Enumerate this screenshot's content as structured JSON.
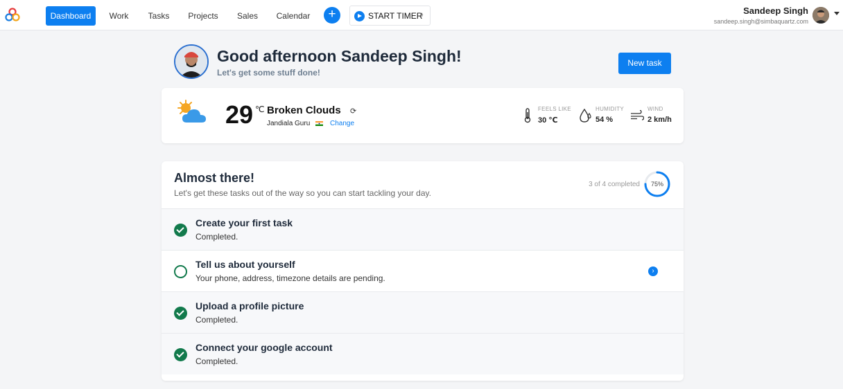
{
  "nav": {
    "items": [
      {
        "label": "Dashboard",
        "active": true
      },
      {
        "label": "Work",
        "active": false
      },
      {
        "label": "Tasks",
        "active": false
      },
      {
        "label": "Projects",
        "active": false
      },
      {
        "label": "Sales",
        "active": false
      },
      {
        "label": "Calendar",
        "active": false
      }
    ],
    "add_label": "+",
    "timer_label": "START TIMER"
  },
  "user": {
    "name": "Sandeep Singh",
    "email": "sandeep.singh@simbaquartz.com"
  },
  "greeting": {
    "title": "Good afternoon Sandeep Singh!",
    "subtitle": "Let's get some stuff done!",
    "new_task_label": "New task"
  },
  "weather": {
    "temperature": "29",
    "unit": "℃",
    "condition": "Broken Clouds",
    "location": "Jandiala Guru",
    "change_label": "Change",
    "metrics": [
      {
        "label": "FEELS LIKE",
        "value": "30 ℃",
        "icon": "thermometer-icon"
      },
      {
        "label": "HUMIDITY",
        "value": "54 %",
        "icon": "humidity-icon"
      },
      {
        "label": "WIND",
        "value": "2 km/h",
        "icon": "wind-icon"
      }
    ]
  },
  "onboarding": {
    "title": "Almost there!",
    "subtitle": "Let's get these tasks out of the way so you can start tackling your day.",
    "progress_text": "3 of 4 completed",
    "progress_pct": "75%",
    "progress_fraction": 0.75,
    "tasks": [
      {
        "name": "Create your first task",
        "desc": "Completed.",
        "done": true
      },
      {
        "name": "Tell us about yourself",
        "desc": "Your phone, address, timezone details are pending.",
        "done": false
      },
      {
        "name": "Upload a profile picture",
        "desc": "Completed.",
        "done": true
      },
      {
        "name": "Connect your google account",
        "desc": "Completed.",
        "done": true
      }
    ]
  },
  "colors": {
    "accent": "#0d7ff0",
    "success": "#127a4c",
    "background": "#f4f5f7"
  }
}
